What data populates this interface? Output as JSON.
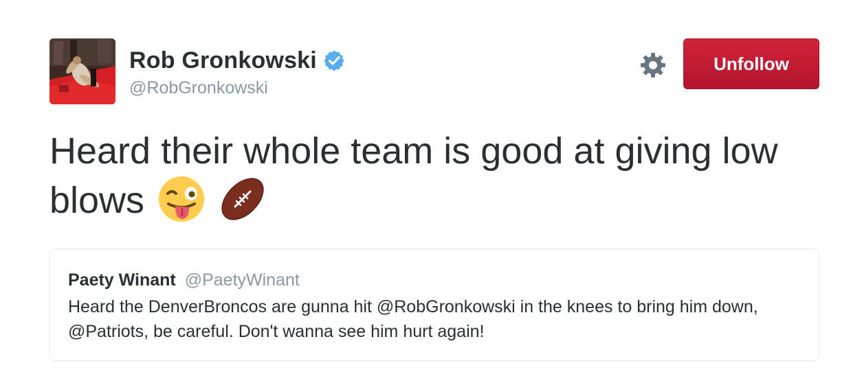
{
  "author": {
    "display_name": "Rob Gronkowski",
    "handle": "@RobGronkowski",
    "verified": true,
    "avatar_icon": "profile-photo"
  },
  "actions": {
    "settings_icon": "gear-icon",
    "unfollow_label": "Unfollow"
  },
  "tweet": {
    "text": "Heard their whole team is good at giving low blows",
    "emojis": [
      "winking-face-with-tongue",
      "american-football"
    ]
  },
  "quoted_tweet": {
    "display_name": "Paety Winant",
    "handle": "@PaetyWinant",
    "text": "Heard the DenverBroncos are gunna hit @RobGronkowski in the knees to bring him down, @Patriots, be careful. Don't wanna see him hurt again!"
  },
  "colors": {
    "unfollow_bg": "#c21b33",
    "verified_blue": "#1da1f2",
    "secondary_text": "#8899a6",
    "primary_text": "#292f33",
    "card_border": "#e1e8ed"
  }
}
